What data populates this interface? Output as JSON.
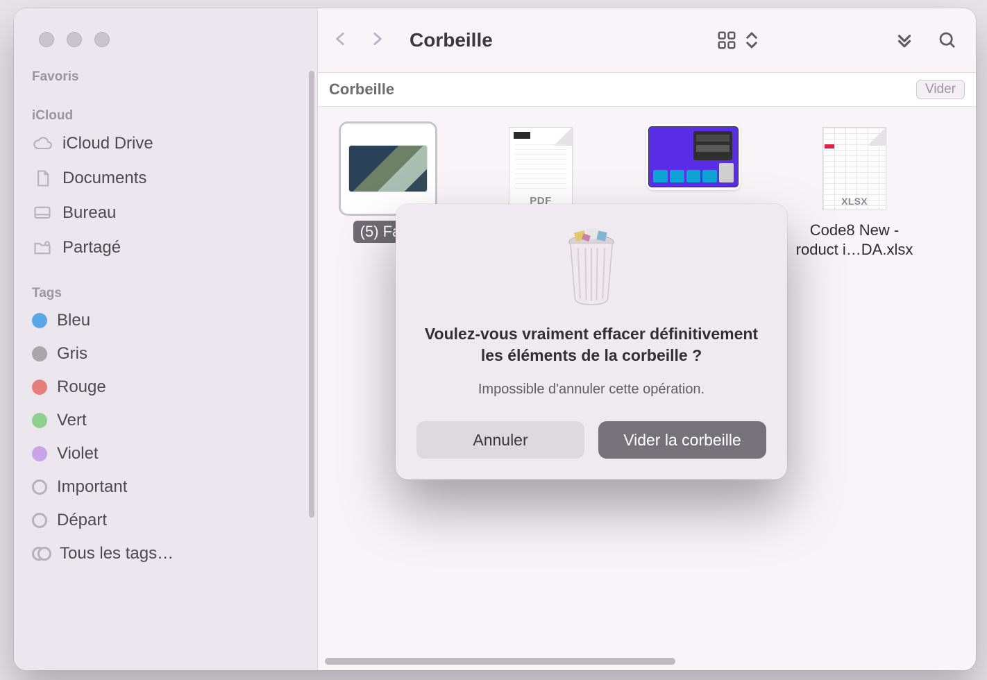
{
  "window": {
    "title": "Corbeille"
  },
  "sidebar": {
    "favorites_label": "Favoris",
    "icloud_label": "iCloud",
    "tags_label": "Tags",
    "icloud_items": [
      {
        "label": "iCloud Drive",
        "icon": "cloud"
      },
      {
        "label": "Documents",
        "icon": "document"
      },
      {
        "label": "Bureau",
        "icon": "desktop"
      },
      {
        "label": "Partagé",
        "icon": "shared-folder"
      }
    ],
    "tags": [
      {
        "label": "Bleu",
        "color": "#5aa7e6"
      },
      {
        "label": "Gris",
        "color": "#a8a5ab"
      },
      {
        "label": "Rouge",
        "color": "#e67f7a"
      },
      {
        "label": "Vert",
        "color": "#8fd08f"
      },
      {
        "label": "Violet",
        "color": "#c9a4e6"
      }
    ],
    "tag_open_items": [
      {
        "label": "Important"
      },
      {
        "label": "Départ"
      }
    ],
    "all_tags_label": "Tous les tags…"
  },
  "toolbar": {
    "view_mode": "icons",
    "empty_button": "Vider"
  },
  "location": {
    "title": "Corbeille"
  },
  "files": [
    {
      "name": "(5) Fa…",
      "kind": "image",
      "selected": true
    },
    {
      "name": "",
      "kind": "pdf",
      "type_label": "PDF"
    },
    {
      "name": "",
      "kind": "screenshot"
    },
    {
      "name": "Code8 New - roduct i…DA.xlsx",
      "kind": "xlsx",
      "type_label": "XLSX"
    }
  ],
  "dialog": {
    "title": "Voulez-vous vraiment effacer définitivement les éléments de la corbeille ?",
    "subtitle": "Impossible d'annuler cette opération.",
    "cancel": "Annuler",
    "confirm": "Vider la corbeille"
  }
}
